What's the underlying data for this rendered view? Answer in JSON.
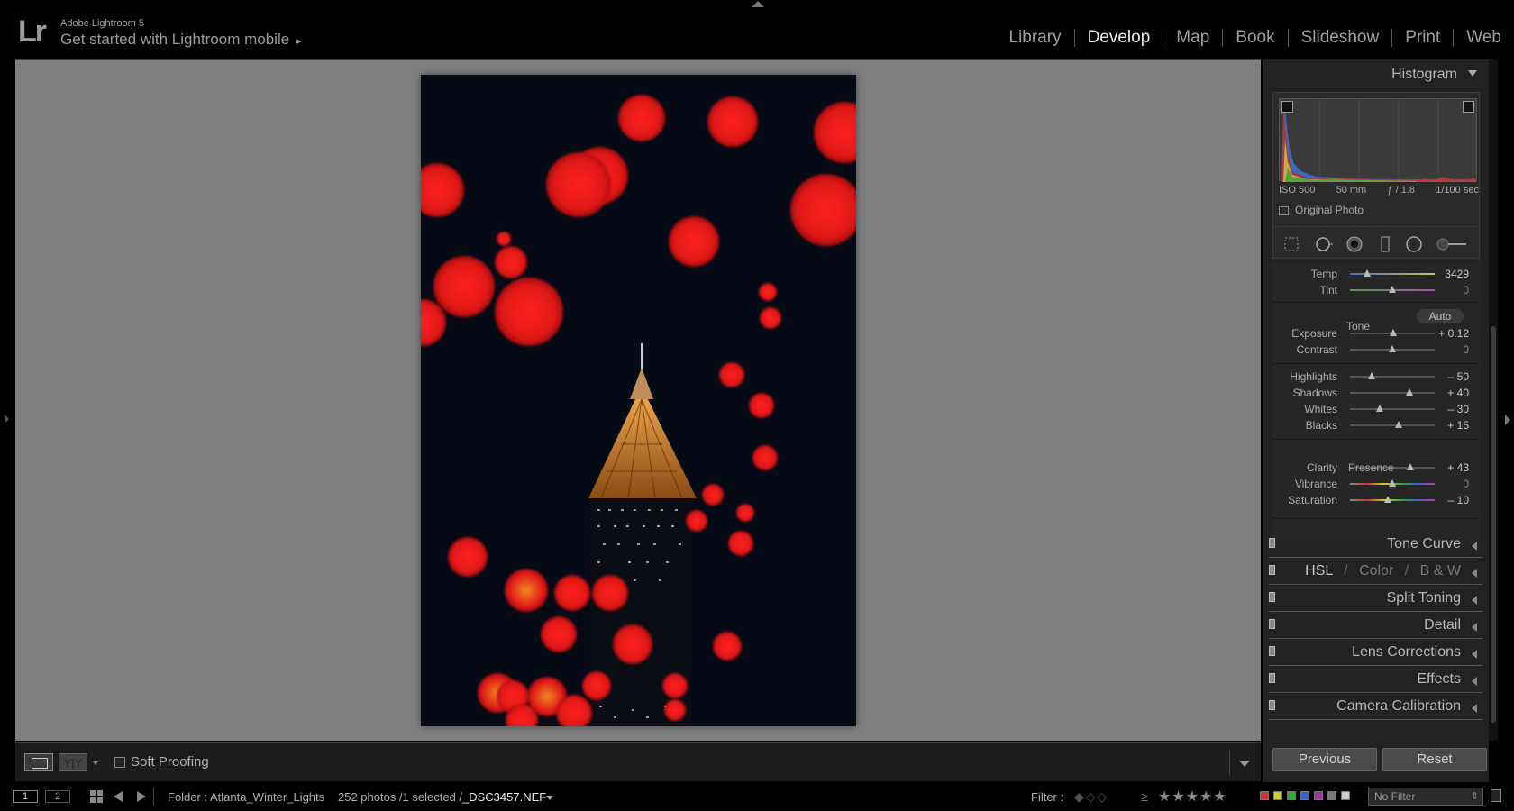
{
  "app": {
    "logo": "Lr",
    "version": "Adobe Lightroom 5",
    "mobile_prompt": "Get started with Lightroom mobile",
    "mobile_arrow": "▸"
  },
  "modules": [
    {
      "label": "Library",
      "active": false
    },
    {
      "label": "Develop",
      "active": true
    },
    {
      "label": "Map",
      "active": false
    },
    {
      "label": "Book",
      "active": false
    },
    {
      "label": "Slideshow",
      "active": false
    },
    {
      "label": "Print",
      "active": false
    },
    {
      "label": "Web",
      "active": false
    }
  ],
  "toolbar": {
    "yy_label": "Y|Y",
    "soft_proofing": "Soft Proofing"
  },
  "histogram": {
    "title": "Histogram",
    "iso": "ISO 500",
    "focal": "50 mm",
    "aperture": "ƒ / 1.8",
    "shutter": "1/100 sec",
    "original_photo": "Original Photo"
  },
  "basic": {
    "wb": [
      {
        "label": "Temp",
        "value": "3429",
        "pos": 0.2,
        "track": "temp"
      },
      {
        "label": "Tint",
        "value": "0",
        "pos": 0.5,
        "track": "tint"
      }
    ],
    "tone_title": "Tone",
    "auto_label": "Auto",
    "tone_a": [
      {
        "label": "Exposure",
        "value": "+ 0.12",
        "pos": 0.51
      },
      {
        "label": "Contrast",
        "value": "0",
        "pos": 0.5
      }
    ],
    "tone_b": [
      {
        "label": "Highlights",
        "value": "– 50",
        "pos": 0.25
      },
      {
        "label": "Shadows",
        "value": "+ 40",
        "pos": 0.7
      },
      {
        "label": "Whites",
        "value": "– 30",
        "pos": 0.35
      },
      {
        "label": "Blacks",
        "value": "+ 15",
        "pos": 0.57
      }
    ],
    "presence_title": "Presence",
    "presence": [
      {
        "label": "Clarity",
        "value": "+ 43",
        "pos": 0.71,
        "track": "plain"
      },
      {
        "label": "Vibrance",
        "value": "0",
        "pos": 0.5,
        "track": "sat"
      },
      {
        "label": "Saturation",
        "value": "– 10",
        "pos": 0.45,
        "track": "sat"
      }
    ]
  },
  "panels": {
    "tone_curve": "Tone Curve",
    "hsl": "HSL",
    "color": "Color",
    "bw": "B & W",
    "hsl_sep": "/",
    "split_toning": "Split Toning",
    "detail": "Detail",
    "lens_corrections": "Lens Corrections",
    "effects": "Effects",
    "camera_calibration": "Camera Calibration"
  },
  "buttons": {
    "previous": "Previous",
    "reset": "Reset"
  },
  "filmstrip": {
    "view1": "1",
    "view2": "2",
    "folder": "Folder : Atlanta_Winter_Lights",
    "count": "252 photos /1 selected /",
    "file": "_DSC3457.NEF",
    "filter_label": "Filter :",
    "flags": "◆◇◇",
    "ge": "≥",
    "stars": "★★★★★",
    "no_filter": "No Filter",
    "color_labels": [
      "#c33",
      "#cc3",
      "#3a3",
      "#36c",
      "#939",
      "#777",
      "#ccc"
    ]
  }
}
